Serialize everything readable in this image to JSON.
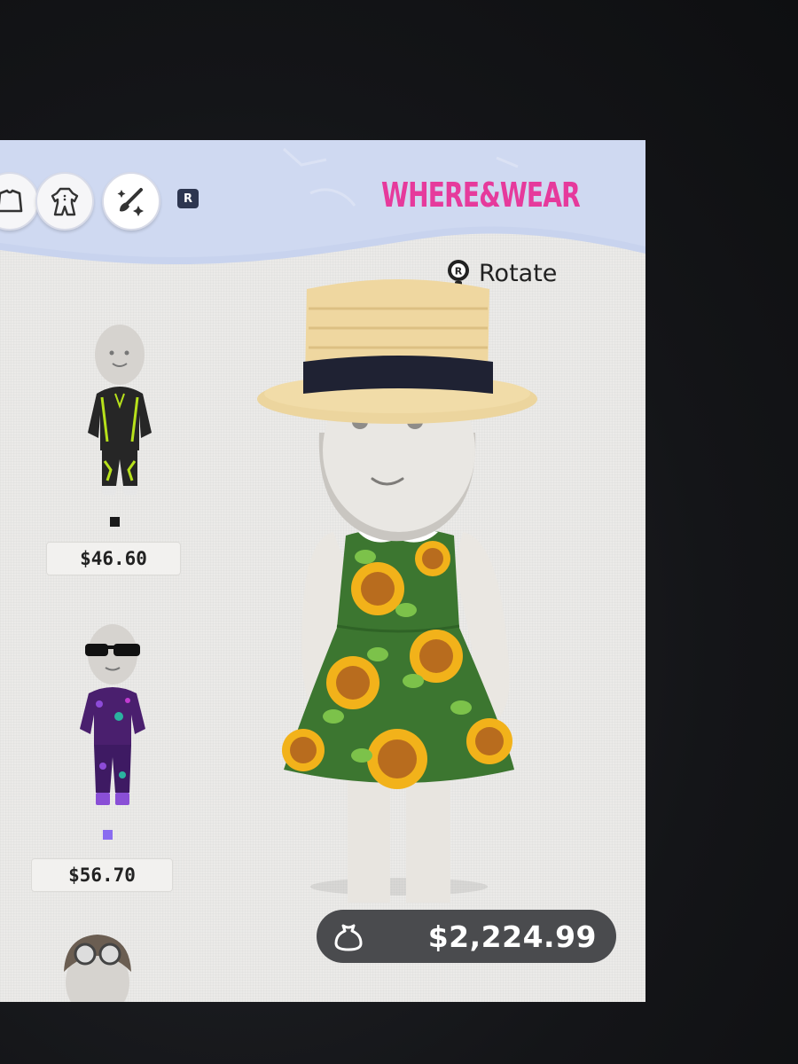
{
  "header": {
    "brand": "WHERE&WEAR",
    "category_buttons": [
      {
        "icon": "top-shirt-icon"
      },
      {
        "icon": "full-outfit-icon"
      },
      {
        "icon": "sparkle-brush-icon"
      }
    ],
    "r_button_label": "R"
  },
  "controls": {
    "rotate_label": "Rotate",
    "rotate_button_icon": "right-stick-icon"
  },
  "items": [
    {
      "price": "$46.60",
      "swatch_color": "#1a1a1a"
    },
    {
      "price": "$56.70",
      "swatch_color": "#8a6cf0"
    }
  ],
  "total": {
    "amount": "$2,224.99",
    "icon": "coin-bag-icon"
  },
  "colors": {
    "brand": "#e63a9c",
    "header_band": "#c9d4ee",
    "dress_green": "#3d7a32",
    "sunflower": "#f2b21a"
  }
}
